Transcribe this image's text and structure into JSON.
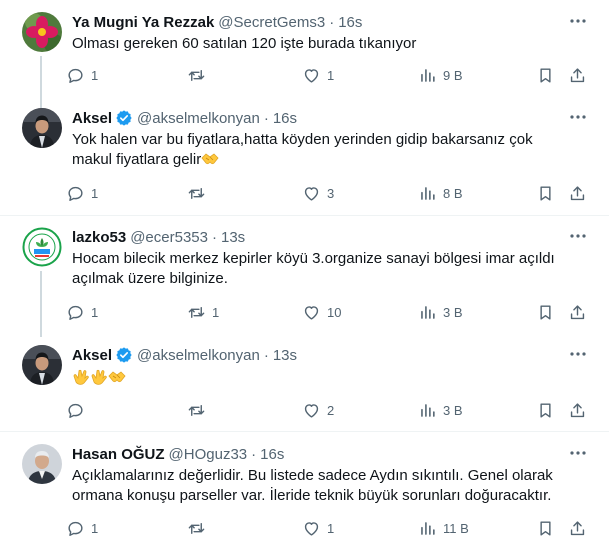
{
  "colors": {
    "text": "#0f1419",
    "secondary": "#536471",
    "verified": "#1d9bf0",
    "divider": "#eff3f4",
    "thread": "#cfd9de"
  },
  "tweets": [
    {
      "name": "Ya Mugni Ya Rezzak",
      "handle": "@SecretGems3",
      "dot": "·",
      "time": "16s",
      "verified": false,
      "text": "Olması gereken 60 satılan 120 işte burada tıkanıyor",
      "emoji": [],
      "replies": "1",
      "retweets": "",
      "likes": "1",
      "views": "9 B"
    },
    {
      "name": "Aksel",
      "handle": "@akselmelkonyan",
      "dot": "·",
      "time": "16s",
      "verified": true,
      "text": "Yok halen var bu fiyatlara,hatta köyden yerinden gidip bakarsanız çok makul fiyatlara gelir",
      "emoji": [
        "handshake-emoji"
      ],
      "replies": "1",
      "retweets": "",
      "likes": "3",
      "views": "8 B"
    },
    {
      "name": "lazko53",
      "handle": "@ecer5353",
      "dot": "·",
      "time": "13s",
      "verified": false,
      "text": "Hocam bilecik merkez kepirler köyü 3.organize sanayi bölgesi imar açıldı açılmak üzere bilginize.",
      "emoji": [],
      "replies": "1",
      "retweets": "1",
      "likes": "10",
      "views": "3 B"
    },
    {
      "name": "Aksel",
      "handle": "@akselmelkonyan",
      "dot": "·",
      "time": "13s",
      "verified": true,
      "text": "",
      "emoji": [
        "clapping-hands-emoji",
        "clapping-hands-emoji",
        "handshake-emoji"
      ],
      "replies": "",
      "retweets": "",
      "likes": "2",
      "views": "3 B"
    },
    {
      "name": "Hasan OĞUZ",
      "handle": "@HOguz33",
      "dot": "·",
      "time": "16s",
      "verified": false,
      "text": "Açıklamalarınız değerlidir. Bu listede sadece Aydın sıkıntılı. Genel olarak ormana konuşu parseller var. İleride teknik büyük sorunları doğuracaktır.",
      "emoji": [],
      "replies": "1",
      "retweets": "",
      "likes": "1",
      "views": "11 B"
    }
  ]
}
